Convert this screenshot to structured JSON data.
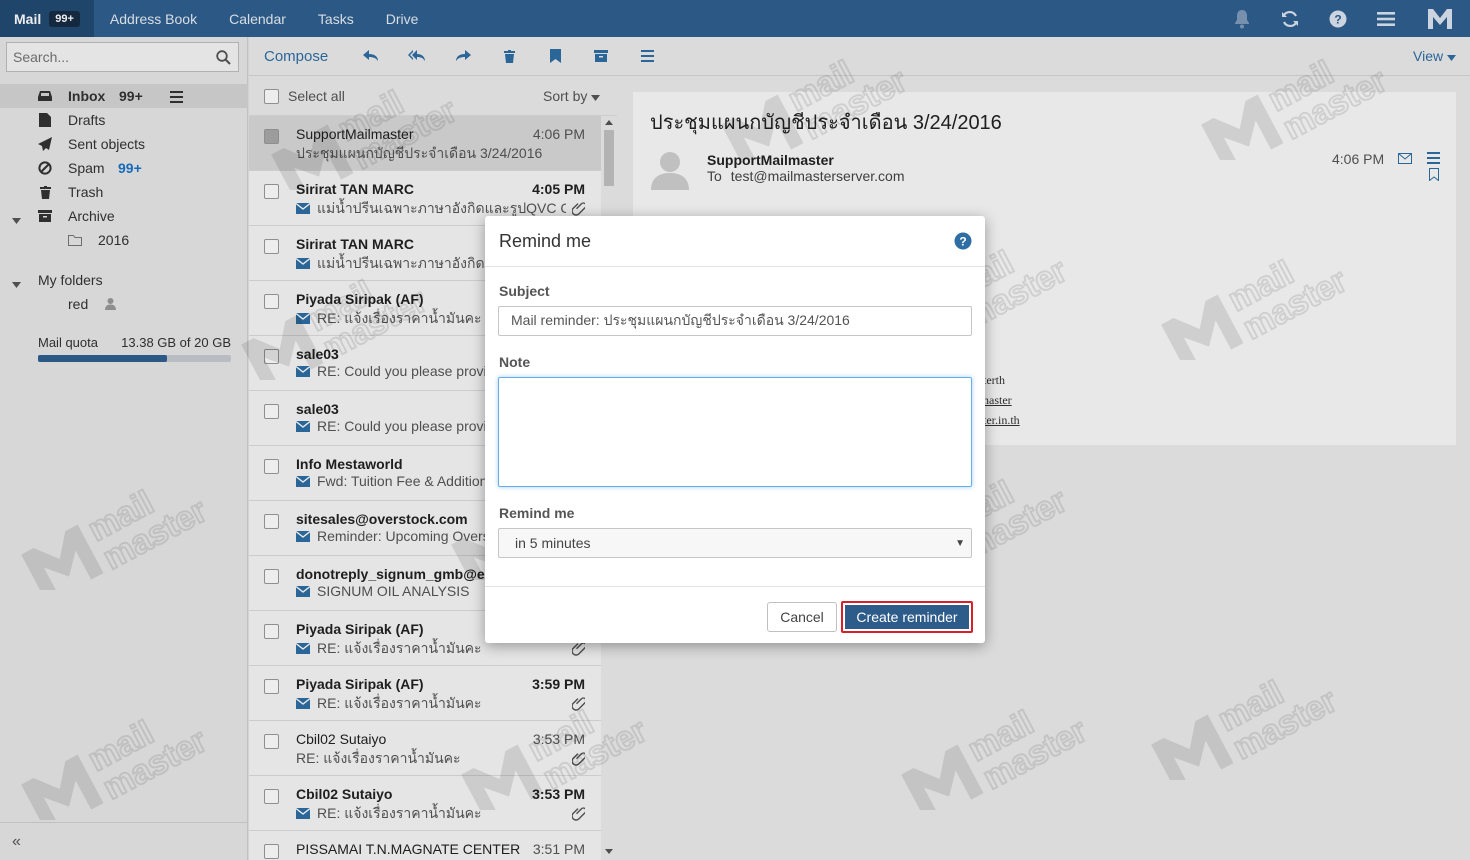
{
  "topnav": {
    "tabs": [
      {
        "label": "Mail",
        "badge": "99+"
      },
      {
        "label": "Address Book"
      },
      {
        "label": "Calendar"
      },
      {
        "label": "Tasks"
      },
      {
        "label": "Drive"
      }
    ],
    "icons": [
      "bell-icon",
      "refresh-icon",
      "help-icon",
      "menu-icon",
      "logo-icon"
    ]
  },
  "sidebar": {
    "search_placeholder": "Search...",
    "folders": [
      {
        "label": "Inbox",
        "count": "99+",
        "icon": "inbox-icon"
      },
      {
        "label": "Drafts",
        "icon": "draft-icon"
      },
      {
        "label": "Sent objects",
        "icon": "send-icon"
      },
      {
        "label": "Spam",
        "count": "99+",
        "icon": "spam-icon"
      },
      {
        "label": "Trash",
        "icon": "trash-icon"
      },
      {
        "label": "Archive",
        "icon": "archive-icon"
      },
      {
        "label": "2016",
        "icon": "folder-icon"
      },
      {
        "label": "My folders"
      },
      {
        "label": "red",
        "icon": "user-icon"
      }
    ],
    "quota": {
      "label": "Mail quota",
      "value": "13.38 GB of 20 GB",
      "fraction": 0.669
    },
    "collapse": "«"
  },
  "toolbar": {
    "compose": "Compose",
    "view": "View"
  },
  "list": {
    "select_all": "Select all",
    "sort": "Sort by",
    "messages": [
      {
        "from": "SupportMailmaster",
        "time": "4:06 PM",
        "subject": "ประชุมแผนกบัญชีประจำเดือน 3/24/2016",
        "unread": false,
        "selected": true,
        "env": false,
        "clip": false
      },
      {
        "from": "Sirirat TAN MARC",
        "time": "4:05 PM",
        "subject": "แม่น้ำปรีนเฉพาะภาษาอังกิดและรูปQVC CH...",
        "unread": true,
        "env": true,
        "clip": true
      },
      {
        "from": "Sirirat TAN MARC",
        "time": "",
        "subject": "แม่น้ำปรีนเฉพาะภาษาอังกิดและ",
        "unread": true,
        "env": true,
        "clip": false
      },
      {
        "from": "Piyada Siripak (AF)",
        "time": "",
        "subject": "RE: แจ้งเรื่องราคาน้ำมันคะ",
        "unread": true,
        "env": true,
        "clip": false
      },
      {
        "from": "sale03",
        "time": "",
        "subject": "RE: Could you please provide",
        "unread": true,
        "env": true,
        "clip": false
      },
      {
        "from": "sale03",
        "time": "",
        "subject": "RE: Could you please provide",
        "unread": true,
        "env": true,
        "clip": false
      },
      {
        "from": "Info Mestaworld",
        "time": "",
        "subject": "Fwd: Tuition Fee & Additiona",
        "unread": true,
        "env": true,
        "clip": false
      },
      {
        "from": "sitesales@overstock.com",
        "time": "",
        "subject": "Reminder: Upcoming Overst",
        "unread": true,
        "env": true,
        "clip": false
      },
      {
        "from": "donotreply_signum_gmb@exx",
        "time": "",
        "subject": "SIGNUM OIL ANALYSIS",
        "unread": true,
        "env": true,
        "clip": false
      },
      {
        "from": "Piyada Siripak (AF)",
        "time": "",
        "subject": "RE: แจ้งเรื่องราคาน้ำมันคะ",
        "unread": true,
        "env": true,
        "clip": true
      },
      {
        "from": "Piyada Siripak (AF)",
        "time": "3:59 PM",
        "subject": "RE: แจ้งเรื่องราคาน้ำมันคะ",
        "unread": true,
        "env": true,
        "clip": true
      },
      {
        "from": "Cbil02 Sutaiyo",
        "time": "3:53 PM",
        "subject": "RE: แจ้งเรื่องราคาน้ำมันคะ",
        "unread": false,
        "env": false,
        "clip": true
      },
      {
        "from": "Cbil02 Sutaiyo",
        "time": "3:53 PM",
        "subject": "RE: แจ้งเรื่องราคาน้ำมันคะ",
        "unread": true,
        "env": true,
        "clip": true
      },
      {
        "from": "PISSAMAI T.N.MAGNATE CENTER",
        "time": "3:51 PM",
        "subject": "",
        "unread": false,
        "env": false,
        "clip": false
      }
    ]
  },
  "reader": {
    "subject": "ประชุมแผนกบัญชีประจำเดือน 3/24/2016",
    "sender": "SupportMailmaster",
    "to_label": "To",
    "to": "test@mailmasterserver.com",
    "time": "4:06 PM",
    "body_lines": [
      "terth",
      "naster",
      "ter.in.th"
    ]
  },
  "dialog": {
    "title": "Remind me",
    "subject_label": "Subject",
    "subject_value": "Mail reminder: ประชุมแผนกบัญชีประจำเดือน 3/24/2016",
    "note_label": "Note",
    "note_value": "",
    "remind_label": "Remind me",
    "remind_value": "in 5 minutes",
    "cancel": "Cancel",
    "create": "Create reminder"
  },
  "colors": {
    "nav": "#2f5f8f",
    "accent": "#2f6ea5",
    "highlight": "#d9202a"
  }
}
